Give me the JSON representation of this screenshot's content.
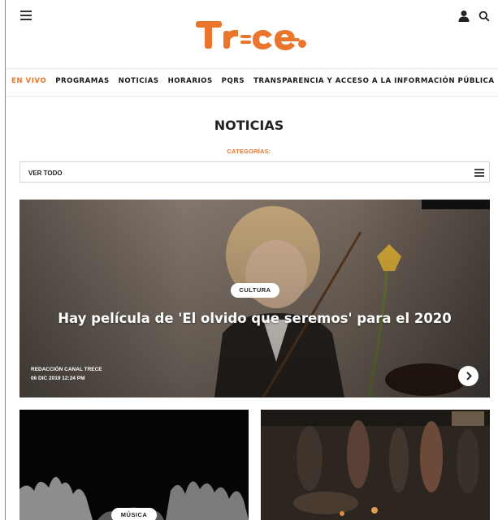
{
  "nav": {
    "items": [
      "EN VIVO",
      "PROGRAMAS",
      "NOTICIAS",
      "HORARIOS",
      "PQRS",
      "TRANSPARENCIA Y ACCESO A LA INFORMACIÓN PÚBLICA"
    ]
  },
  "page": {
    "title": "NOTICIAS",
    "categories_label": "CATEGORÍAS:",
    "filter_label": "VER TODO"
  },
  "hero": {
    "category": "CULTURA",
    "title": "Hay película de 'El olvido que seremos' para el 2020",
    "author": "REDACCIÓN CANAL TRECE",
    "date": "06 DIC 2019 12:24 PM"
  },
  "cards": [
    {
      "category": "MÚSICA"
    },
    {
      "category": ""
    }
  ],
  "colors": {
    "accent": "#e9762c",
    "text": "#1a1a1a"
  },
  "icons": [
    "menu-icon",
    "user-icon",
    "search-icon",
    "chevron-right-icon"
  ]
}
